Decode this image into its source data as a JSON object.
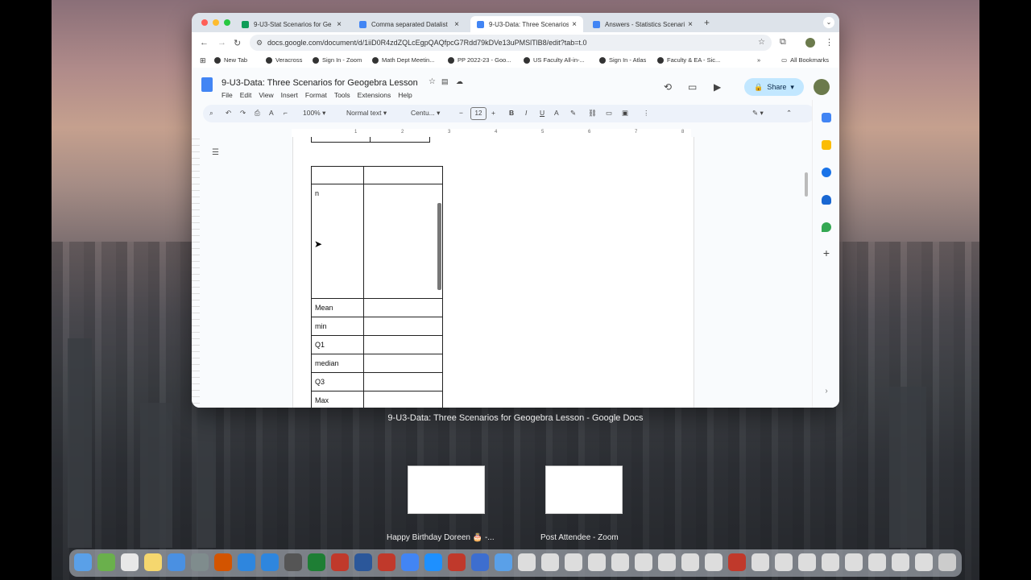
{
  "browser": {
    "tabs": [
      {
        "label": "9-U3-Stat Scenarios for Ge",
        "active": false,
        "icon_color": "#0f9d58"
      },
      {
        "label": "Comma separated Datalist",
        "active": false,
        "icon_color": "#4285f4"
      },
      {
        "label": "9-U3-Data: Three Scenarios",
        "active": true,
        "icon_color": "#4285f4"
      },
      {
        "label": "Answers - Statistics Scenaric",
        "active": false,
        "icon_color": "#4285f4"
      }
    ],
    "url": "docs.google.com/document/d/1iiD0R4zdZQLcEgpQAQfpcG7Rdd79kDVe13uPMSlTlB8/edit?tab=t.0",
    "bookmarks": [
      "New Tab",
      "Veracross",
      "Sign In - Zoom",
      "Math Dept Meetin...",
      "PP 2022-23 - Goo...",
      "US Faculty All-in-...",
      "Sign In - Atlas",
      "Faculty & EA - Sic..."
    ],
    "all_bookmarks": "All Bookmarks"
  },
  "doc": {
    "title": "9-U3-Data: Three Scenarios for Geogebra Lesson",
    "menu": [
      "File",
      "Edit",
      "View",
      "Insert",
      "Format",
      "Tools",
      "Extensions",
      "Help"
    ],
    "share": "Share",
    "toolbar": {
      "zoom": "100%",
      "style": "Normal text",
      "font": "Centu...",
      "size": "12"
    },
    "ruler_ticks": [
      "1",
      "2",
      "3",
      "4",
      "5",
      "6",
      "7",
      "8"
    ],
    "table_rows": [
      {
        "label": "",
        "value": ""
      },
      {
        "label": "n",
        "value": ""
      },
      {
        "label": "Mean",
        "value": ""
      },
      {
        "label": "min",
        "value": ""
      },
      {
        "label": "Q1",
        "value": ""
      },
      {
        "label": "median",
        "value": ""
      },
      {
        "label": "Q3",
        "value": ""
      },
      {
        "label": "Max",
        "value": ""
      }
    ]
  },
  "desktop": {
    "window_title": "9-U3-Data: Three Scenarios for Geogebra Lesson - Google Docs",
    "other_windows": [
      "Happy Birthday Doreen 🎂 -...",
      "Post Attendee - Zoom"
    ]
  }
}
